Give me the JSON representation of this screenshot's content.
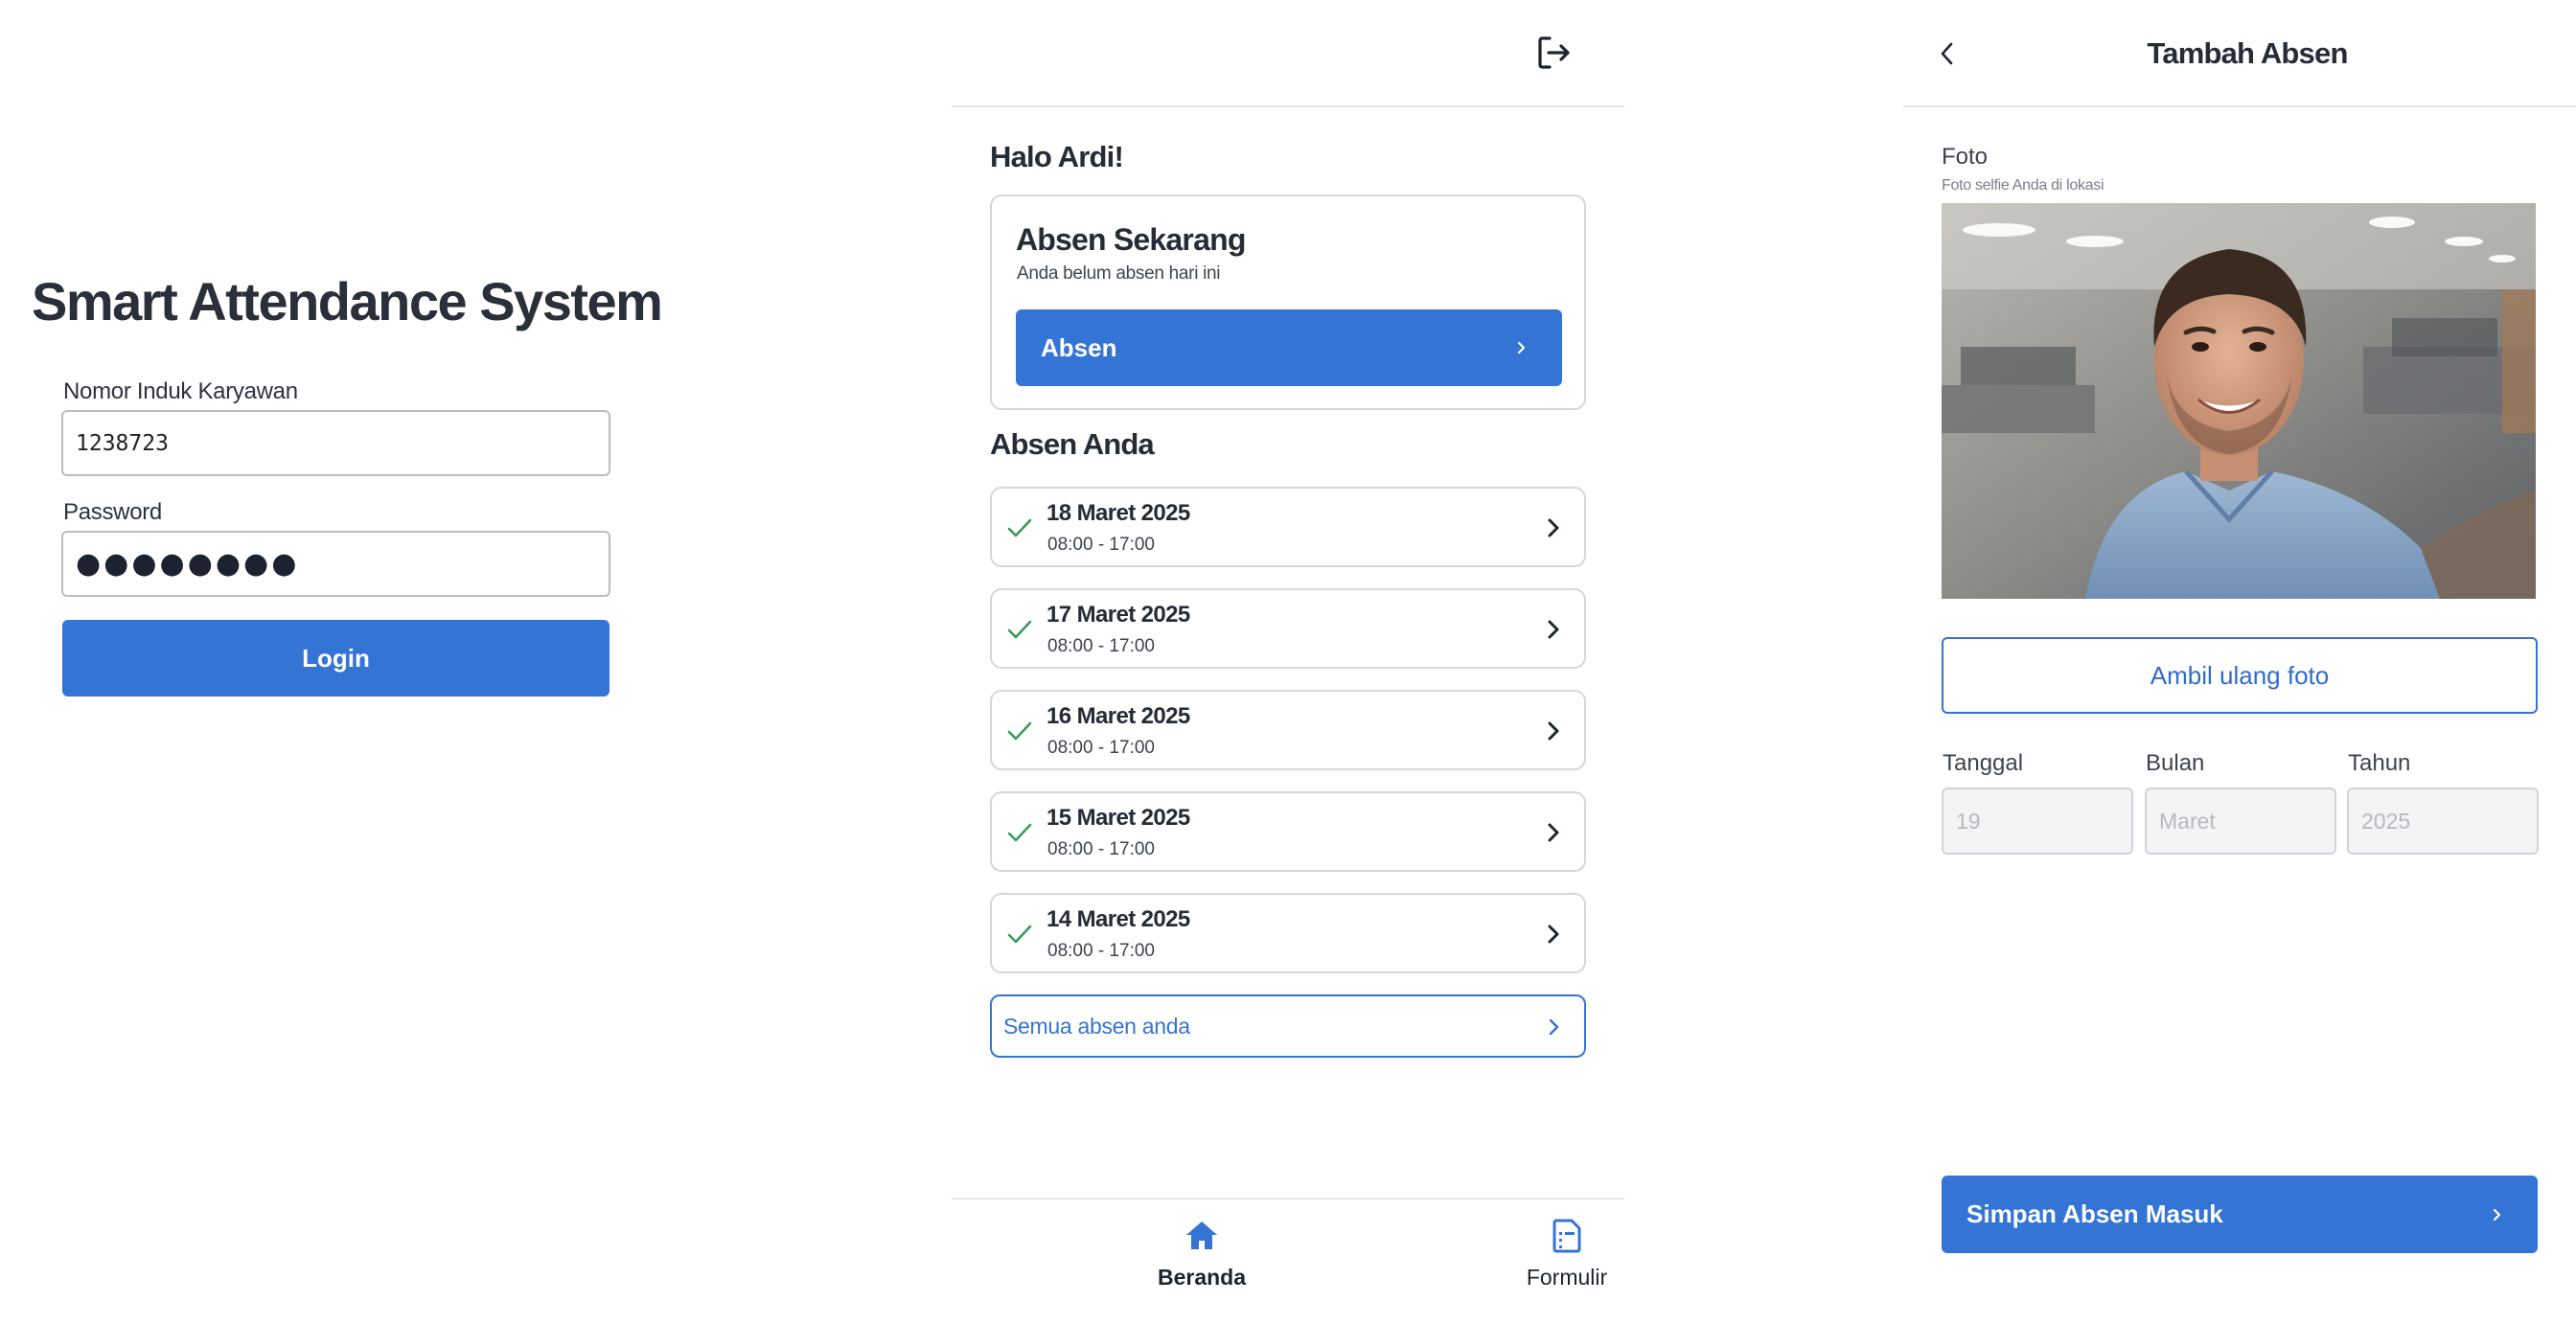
{
  "login": {
    "title": "Smart Attendance System",
    "employee_id_label": "Nomor Induk Karyawan",
    "employee_id_value": "1238723",
    "password_label": "Password",
    "password_value": "●●●●●●●●",
    "login_label": "Login"
  },
  "home": {
    "logout_icon": "logout-icon",
    "greeting": "Halo Ardi!",
    "card": {
      "title": "Absen Sekarang",
      "subtitle": "Anda belum absen hari ini",
      "button_label": "Absen"
    },
    "history_title": "Absen Anda",
    "history": [
      {
        "date": "18 Maret 2025",
        "time": "08:00 - 17:00"
      },
      {
        "date": "17 Maret 2025",
        "time": "08:00 - 17:00"
      },
      {
        "date": "16 Maret 2025",
        "time": "08:00 - 17:00"
      },
      {
        "date": "15 Maret 2025",
        "time": "08:00 - 17:00"
      },
      {
        "date": "14 Maret 2025",
        "time": "08:00 - 17:00"
      }
    ],
    "all_link": "Semua absen anda",
    "nav": [
      {
        "label": "Beranda",
        "icon": "home-icon",
        "active": true
      },
      {
        "label": "Formulir",
        "icon": "form-icon",
        "active": false
      }
    ]
  },
  "add": {
    "title": "Tambah Absen",
    "photo_label": "Foto",
    "photo_hint": "Foto selfie Anda di lokasi",
    "retake_label": "Ambil ulang foto",
    "fields": [
      {
        "label": "Tanggal",
        "value": "19"
      },
      {
        "label": "Bulan",
        "value": "Maret"
      },
      {
        "label": "Tahun",
        "value": "2025"
      }
    ],
    "save_label": "Simpan Absen Masuk"
  },
  "colors": {
    "primary": "#3474d4",
    "success_check": "#3b9a57",
    "text": "#262b36",
    "border": "#d5d7db"
  }
}
